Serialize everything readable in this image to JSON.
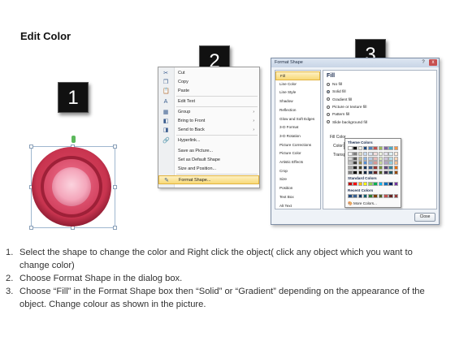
{
  "title": "Edit Color",
  "steps_numbers": [
    "1",
    "2",
    "3"
  ],
  "context_menu": {
    "items": [
      {
        "icon": "cut-icon",
        "glyph": "✂",
        "label": "Cut",
        "arrow": ""
      },
      {
        "icon": "copy-icon",
        "glyph": "❐",
        "label": "Copy",
        "arrow": ""
      },
      {
        "icon": "paste-icon",
        "glyph": "📋",
        "label": "Paste",
        "arrow": ""
      },
      {
        "icon": "edit-text-icon",
        "glyph": "A",
        "label": "Edit Text",
        "arrow": ""
      },
      {
        "icon": "group-icon",
        "glyph": "▦",
        "label": "Group",
        "arrow": "›"
      },
      {
        "icon": "bring-to-front-icon",
        "glyph": "◧",
        "label": "Bring to Front",
        "arrow": "›"
      },
      {
        "icon": "send-to-back-icon",
        "glyph": "◨",
        "label": "Send to Back",
        "arrow": "›"
      },
      {
        "icon": "hyperlink-icon",
        "glyph": "🔗",
        "label": "Hyperlink...",
        "arrow": ""
      },
      {
        "icon": "save-as-picture-icon",
        "glyph": "",
        "label": "Save as Picture...",
        "arrow": ""
      },
      {
        "icon": "set-default-icon",
        "glyph": "",
        "label": "Set as Default Shape",
        "arrow": ""
      },
      {
        "icon": "size-position-icon",
        "glyph": "",
        "label": "Size and Position...",
        "arrow": ""
      },
      {
        "icon": "format-shape-icon",
        "glyph": "✎",
        "label": "Format Shape...",
        "arrow": ""
      }
    ]
  },
  "dialog": {
    "title": "Format Shape",
    "help": "?",
    "close_x": "x",
    "close_button": "Close",
    "categories": [
      "Fill",
      "Line Color",
      "Line Style",
      "Shadow",
      "Reflection",
      "Glow and Soft Edges",
      "3-D Format",
      "3-D Rotation",
      "Picture Corrections",
      "Picture Color",
      "Artistic Effects",
      "Crop",
      "Size",
      "Position",
      "Text Box",
      "Alt Text"
    ],
    "selected_category": "Fill",
    "fill_heading": "Fill",
    "fill_options": [
      {
        "label": "No fill",
        "checked": false
      },
      {
        "label": "Solid fill",
        "checked": true
      },
      {
        "label": "Gradient fill",
        "checked": false
      },
      {
        "label": "Picture or texture fill",
        "checked": false
      },
      {
        "label": "Pattern fill",
        "checked": false
      },
      {
        "label": "Slide background fill",
        "checked": false
      }
    ],
    "fill_color_heading": "Fill Color",
    "color_label": "Color:",
    "transparency_label": "Transpa",
    "palette": {
      "theme_heading": "Theme Colors",
      "standard_heading": "Standard Colors",
      "recent_heading": "Recent Colors",
      "more_colors": "More Colors...",
      "theme_top": [
        "#ffffff",
        "#000000",
        "#eeece1",
        "#1f497d",
        "#4f81bd",
        "#c0504d",
        "#9bbb59",
        "#8064a2",
        "#4bacc6",
        "#f79646"
      ],
      "theme_shades": [
        [
          "#f2f2f2",
          "#7f7f7f",
          "#ddd9c3",
          "#c6d9f0",
          "#dbe5f1",
          "#f2dcdb",
          "#ebf1dd",
          "#e5e0ec",
          "#dbeef3",
          "#fdeada"
        ],
        [
          "#d8d8d8",
          "#595959",
          "#c4bd97",
          "#8db3e2",
          "#b8cce4",
          "#e5b9b7",
          "#d7e3bc",
          "#ccc1d9",
          "#b7dde8",
          "#fbd5b5"
        ],
        [
          "#bfbfbf",
          "#3f3f3f",
          "#938953",
          "#548dd4",
          "#95b3d7",
          "#d99694",
          "#c3d69b",
          "#b2a2c7",
          "#92cddc",
          "#fac08f"
        ],
        [
          "#a5a5a5",
          "#262626",
          "#494429",
          "#17365d",
          "#366092",
          "#953734",
          "#76923c",
          "#5f497a",
          "#31859b",
          "#e36c09"
        ],
        [
          "#7f7f7f",
          "#0c0c0c",
          "#1d1b10",
          "#0f243e",
          "#244061",
          "#632423",
          "#4f6128",
          "#3f3151",
          "#205867",
          "#974806"
        ]
      ],
      "standard": [
        "#c00000",
        "#ff0000",
        "#ffc000",
        "#ffff00",
        "#92d050",
        "#00b050",
        "#00b0f0",
        "#0070c0",
        "#002060",
        "#7030a0"
      ],
      "recent": [
        "#1f497d",
        "#376092",
        "#17375e",
        "#0e5c6d",
        "#2e7d32",
        "#7f3f00",
        "#4f6228",
        "#c0504d",
        "#632523",
        "#953735"
      ]
    }
  },
  "instructions": [
    {
      "n": "1.",
      "text": "Select the shape to change the color and Right click the object( click any object which you want to change color)"
    },
    {
      "n": "2.",
      "text": "Choose Format Shape in the dialog box."
    },
    {
      "n": "3.",
      "text": "Choose “Fill” in the Format Shape box then “Solid” or “Gradient” depending on the appearance of the object. Change colour as shown in the picture."
    }
  ],
  "colors": {
    "shape_outer": "#c8344f",
    "shape_mid": "#e45a78",
    "shape_inner": "#f4a6bb",
    "menu_highlight": "#f8d978"
  }
}
